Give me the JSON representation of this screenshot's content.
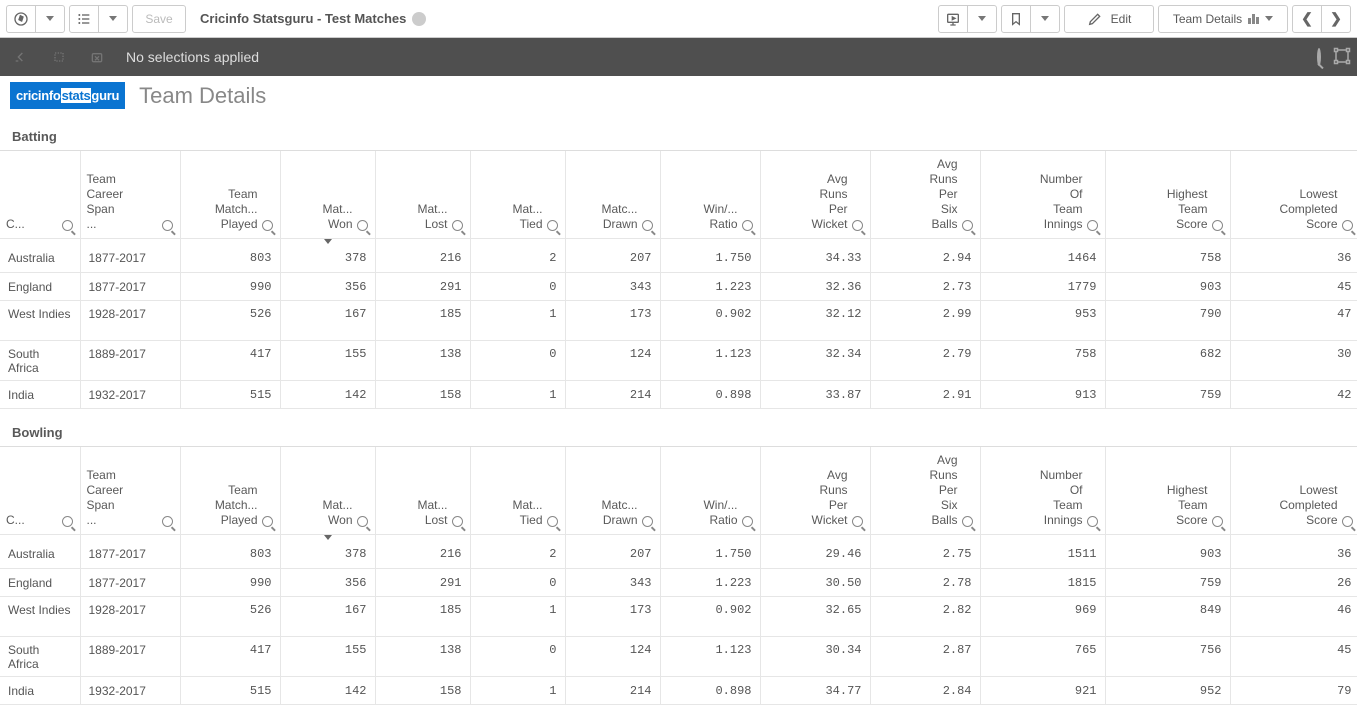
{
  "toolbar": {
    "save_label": "Save",
    "app_title": "Cricinfo Statsguru - Test Matches",
    "edit_label": "Edit",
    "view_label": "Team Details"
  },
  "selection_bar": {
    "text": "No selections applied"
  },
  "sheet": {
    "logo_part1": "cricinfo",
    "logo_part2": "stats",
    "logo_part3": "guru",
    "title": "Team Details"
  },
  "sections": [
    {
      "title": "Batting"
    },
    {
      "title": "Bowling"
    }
  ],
  "columns": [
    {
      "label": "C...",
      "align": "left"
    },
    {
      "label": "Team Career Span ...",
      "align": "left"
    },
    {
      "label": "Team Match... Played",
      "align": "right"
    },
    {
      "label": "Mat... Won",
      "align": "right"
    },
    {
      "label": "Mat... Lost",
      "align": "right"
    },
    {
      "label": "Mat... Tied",
      "align": "right"
    },
    {
      "label": "Matc... Drawn",
      "align": "right"
    },
    {
      "label": "Win/... Ratio",
      "align": "right"
    },
    {
      "label": "Avg Runs Per Wicket",
      "align": "right"
    },
    {
      "label": "Avg Runs Per Six Balls",
      "align": "right"
    },
    {
      "label": "Number Of Team Innings",
      "align": "right"
    },
    {
      "label": "Highest Team Score",
      "align": "right"
    },
    {
      "label": "Lowest Completed Score",
      "align": "right"
    }
  ],
  "batting_rows": [
    {
      "country": "Australia",
      "span": "1877-2017",
      "played": "803",
      "won": "378",
      "lost": "216",
      "tied": "2",
      "drawn": "207",
      "ratio": "1.750",
      "arpw": "34.33",
      "arpsb": "2.94",
      "innings": "1464",
      "high": "758",
      "low": "36",
      "tall": false
    },
    {
      "country": "England",
      "span": "1877-2017",
      "played": "990",
      "won": "356",
      "lost": "291",
      "tied": "0",
      "drawn": "343",
      "ratio": "1.223",
      "arpw": "32.36",
      "arpsb": "2.73",
      "innings": "1779",
      "high": "903",
      "low": "45",
      "tall": false
    },
    {
      "country": "West Indies",
      "span": "1928-2017",
      "played": "526",
      "won": "167",
      "lost": "185",
      "tied": "1",
      "drawn": "173",
      "ratio": "0.902",
      "arpw": "32.12",
      "arpsb": "2.99",
      "innings": "953",
      "high": "790",
      "low": "47",
      "tall": true
    },
    {
      "country": "South Africa",
      "span": "1889-2017",
      "played": "417",
      "won": "155",
      "lost": "138",
      "tied": "0",
      "drawn": "124",
      "ratio": "1.123",
      "arpw": "32.34",
      "arpsb": "2.79",
      "innings": "758",
      "high": "682",
      "low": "30",
      "tall": true
    },
    {
      "country": "India",
      "span": "1932-2017",
      "played": "515",
      "won": "142",
      "lost": "158",
      "tied": "1",
      "drawn": "214",
      "ratio": "0.898",
      "arpw": "33.87",
      "arpsb": "2.91",
      "innings": "913",
      "high": "759",
      "low": "42",
      "tall": false
    }
  ],
  "bowling_rows": [
    {
      "country": "Australia",
      "span": "1877-2017",
      "played": "803",
      "won": "378",
      "lost": "216",
      "tied": "2",
      "drawn": "207",
      "ratio": "1.750",
      "arpw": "29.46",
      "arpsb": "2.75",
      "innings": "1511",
      "high": "903",
      "low": "36",
      "tall": false
    },
    {
      "country": "England",
      "span": "1877-2017",
      "played": "990",
      "won": "356",
      "lost": "291",
      "tied": "0",
      "drawn": "343",
      "ratio": "1.223",
      "arpw": "30.50",
      "arpsb": "2.78",
      "innings": "1815",
      "high": "759",
      "low": "26",
      "tall": false
    },
    {
      "country": "West Indies",
      "span": "1928-2017",
      "played": "526",
      "won": "167",
      "lost": "185",
      "tied": "1",
      "drawn": "173",
      "ratio": "0.902",
      "arpw": "32.65",
      "arpsb": "2.82",
      "innings": "969",
      "high": "849",
      "low": "46",
      "tall": true
    },
    {
      "country": "South Africa",
      "span": "1889-2017",
      "played": "417",
      "won": "155",
      "lost": "138",
      "tied": "0",
      "drawn": "124",
      "ratio": "1.123",
      "arpw": "30.34",
      "arpsb": "2.87",
      "innings": "765",
      "high": "756",
      "low": "45",
      "tall": true
    },
    {
      "country": "India",
      "span": "1932-2017",
      "played": "515",
      "won": "142",
      "lost": "158",
      "tied": "1",
      "drawn": "214",
      "ratio": "0.898",
      "arpw": "34.77",
      "arpsb": "2.84",
      "innings": "921",
      "high": "952",
      "low": "79",
      "tall": false
    }
  ]
}
